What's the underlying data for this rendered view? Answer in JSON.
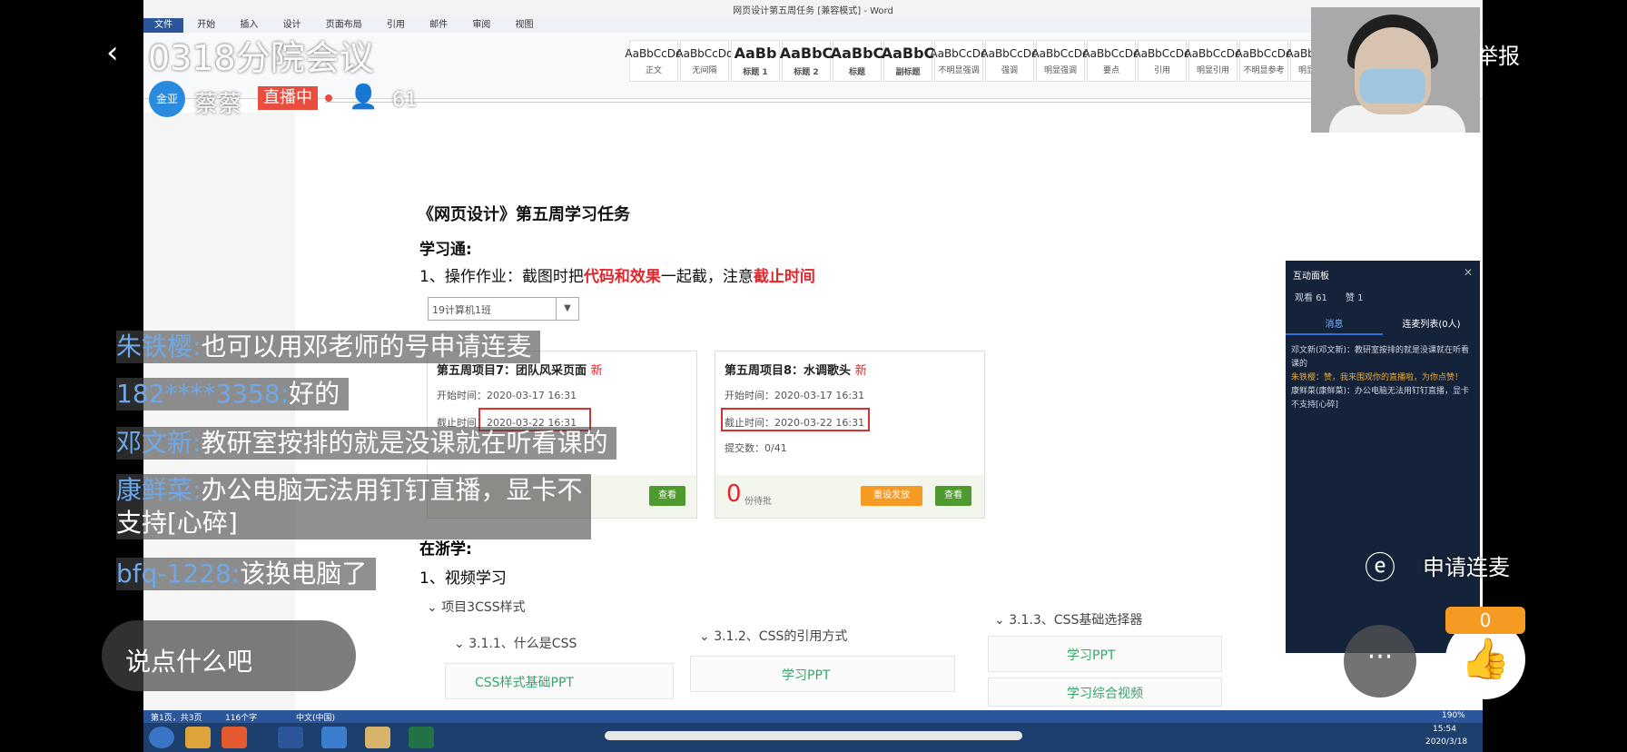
{
  "stream": {
    "title": "0318分院会议",
    "host": "蔡蔡",
    "avatar_text": "金亚",
    "live_badge": "直播中",
    "viewers": "61",
    "report_label": "举报",
    "input_placeholder": "说点什么吧",
    "request_mic_label": "申请连麦",
    "like_count": "0"
  },
  "word": {
    "window_title": "网页设计第五周任务 [兼容模式] - Word",
    "menus": [
      "文件",
      "开始",
      "插入",
      "设计",
      "页面布局",
      "引用",
      "邮件",
      "审阅",
      "视图"
    ],
    "styles": [
      {
        "sample": "AaBbCcDd",
        "name": "正文"
      },
      {
        "sample": "AaBbCcDd",
        "name": "无间隔"
      },
      {
        "sample": "AaBb",
        "name": "标题 1"
      },
      {
        "sample": "AaBbC",
        "name": "标题 2"
      },
      {
        "sample": "AaBbC",
        "name": "标题"
      },
      {
        "sample": "AaBbC",
        "name": "副标题"
      },
      {
        "sample": "AaBbCcDd",
        "name": "不明显强调"
      },
      {
        "sample": "AaBbCcDd",
        "name": "强调"
      },
      {
        "sample": "AaBbCcDd",
        "name": "明显强调"
      },
      {
        "sample": "AaBbCcDd",
        "name": "要点"
      },
      {
        "sample": "AaBbCcDd",
        "name": "引用"
      },
      {
        "sample": "AaBbCcDd",
        "name": "明显引用"
      },
      {
        "sample": "AaBbCcDd",
        "name": "不明显参考"
      },
      {
        "sample": "AaBbCcDd",
        "name": "明显参考"
      }
    ],
    "doc": {
      "heading": "《网页设计》第五周学习任务",
      "section1": "学习通:",
      "task_prefix": "1、操作作业：截图时把",
      "task_red1": "代码和效果",
      "task_mid": "一起截，注意",
      "task_red2": "截止时间",
      "class_select": "19计算机1班",
      "cards": [
        {
          "title": "第五周项目7：团队风采页面",
          "new": "新",
          "start": "开始时间：2020-03-17 16:31",
          "end": "截止时间：2020-03-22 16:31"
        },
        {
          "title": "第五周项目8：水调歌头",
          "new": "新",
          "start": "开始时间：2020-03-17 16:31",
          "end": "截止时间：2020-03-22 16:31",
          "submitted": "提交数：0/41",
          "pending_num": "0",
          "pending_label": "份待批",
          "republish": "重设发放",
          "view": "查看"
        }
      ],
      "section2": "在浙学:",
      "video": "1、视频学习",
      "tree_root": "项目3CSS样式",
      "tree_items": [
        "3.1.1、什么是CSS",
        "3.1.2、CSS的引用方式",
        "3.1.3、CSS基础选择器"
      ],
      "resources": [
        "CSS样式基础PPT",
        "学习PPT",
        "学习PPT",
        "学习综合视频"
      ]
    },
    "status": {
      "page": "第1页，共3页",
      "words": "116个字",
      "lang": "中文(中国)",
      "zoom": "190%",
      "time": "15:54",
      "date": "2020/3/18"
    }
  },
  "chat": [
    {
      "name": "朱铁樱:",
      "text": "也可以用邓老师的号申请连麦"
    },
    {
      "name": "182****3358:",
      "text": "好的"
    },
    {
      "name": "邓文新:",
      "text": "教研室按排的就是没课就在听看课的"
    },
    {
      "name": "康鲜菜:",
      "text": "办公电脑无法用钉钉直播，显卡不",
      "text2": "支持[心碎]"
    },
    {
      "name": "bfq-1228:",
      "text": "该换电脑了"
    }
  ],
  "panel": {
    "title": "互动面板",
    "viewers": "观看 61",
    "likes": "赞 1",
    "tab_chat": "消息",
    "tab_mic": "连麦列表(0人)",
    "messages": [
      "邓文新(邓文新)：教研室按排的就是没课就在听看课的",
      "朱铁樱：赞，我来围观你的直播啦，为你点赞！",
      "康鲜菜(康鲜菜)：办公电脑无法用钉钉直播，显卡不支持[心碎]"
    ]
  },
  "colors": {
    "accent": "#2b579a",
    "live": "#e84d3d",
    "like": "#f59a23",
    "green_btn": "#4f9a2f",
    "red_text": "#e3262b"
  }
}
